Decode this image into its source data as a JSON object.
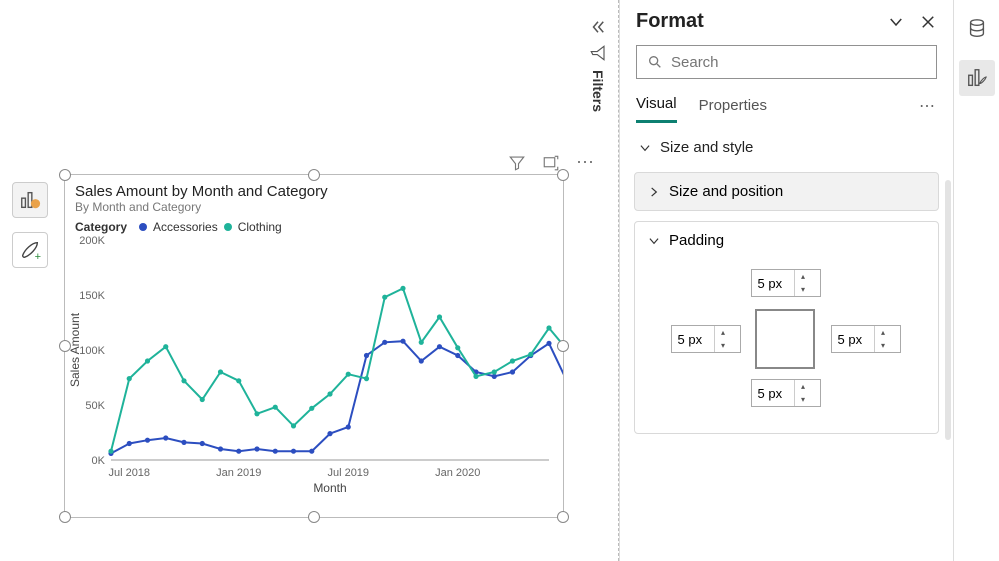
{
  "canvas": {
    "visual_header": {
      "filter_icon": "filter-icon",
      "focus_icon": "focus-mode-icon",
      "more_icon": "more-icon"
    },
    "mini_toolbar": {
      "build_icon": "build-visual-icon",
      "format_icon": "format-visual-icon"
    }
  },
  "chart_data": {
    "type": "line",
    "title": "Sales Amount by Month and Category",
    "subtitle": "By Month and Category",
    "xlabel": "Month",
    "ylabel": "Sales Amount",
    "ylim": [
      0,
      200000
    ],
    "y_ticks": [
      0,
      50000,
      100000,
      150000,
      200000
    ],
    "y_tick_labels": [
      "0K",
      "50K",
      "100K",
      "150K",
      "200K"
    ],
    "x_tick_labels": [
      "Jul 2018",
      "Jan 2019",
      "Jul 2019",
      "Jan 2020"
    ],
    "legend_title": "Category",
    "months": [
      "Jun 2018",
      "Jul 2018",
      "Aug 2018",
      "Sep 2018",
      "Oct 2018",
      "Nov 2018",
      "Dec 2018",
      "Jan 2019",
      "Feb 2019",
      "Mar 2019",
      "Apr 2019",
      "May 2019",
      "Jun 2019",
      "Jul 2019",
      "Aug 2019",
      "Sep 2019",
      "Oct 2019",
      "Nov 2019",
      "Dec 2019",
      "Jan 2020",
      "Feb 2020",
      "Mar 2020",
      "Apr 2020",
      "May 2020",
      "Jun 2020"
    ],
    "series": [
      {
        "name": "Accessories",
        "color": "#2c4ec0",
        "values": [
          6000,
          15000,
          18000,
          20000,
          16000,
          15000,
          10000,
          8000,
          10000,
          8000,
          8000,
          8000,
          24000,
          30000,
          95000,
          107000,
          108000,
          90000,
          103000,
          95000,
          80000,
          76000,
          80000,
          95000,
          106000,
          71000
        ]
      },
      {
        "name": "Clothing",
        "color": "#1fb39a",
        "values": [
          8000,
          74000,
          90000,
          103000,
          72000,
          55000,
          80000,
          72000,
          42000,
          48000,
          31000,
          47000,
          60000,
          78000,
          74000,
          148000,
          156000,
          107000,
          130000,
          102000,
          76000,
          80000,
          90000,
          96000,
          120000,
          100000
        ]
      }
    ]
  },
  "filters_tab": {
    "label": "Filters"
  },
  "format_pane": {
    "title": "Format",
    "search_placeholder": "Search",
    "tabs": {
      "visual": "Visual",
      "properties": "Properties"
    }
  },
  "sections": {
    "size_style": {
      "label": "Size and style"
    },
    "size_position": {
      "label": "Size and position"
    },
    "padding": {
      "label": "Padding",
      "top": "5 px",
      "bottom": "5 px",
      "left": "5 px",
      "right": "5 px"
    }
  },
  "rail": {
    "data_icon": "data-icon",
    "format_icon": "format-brush-icon"
  }
}
